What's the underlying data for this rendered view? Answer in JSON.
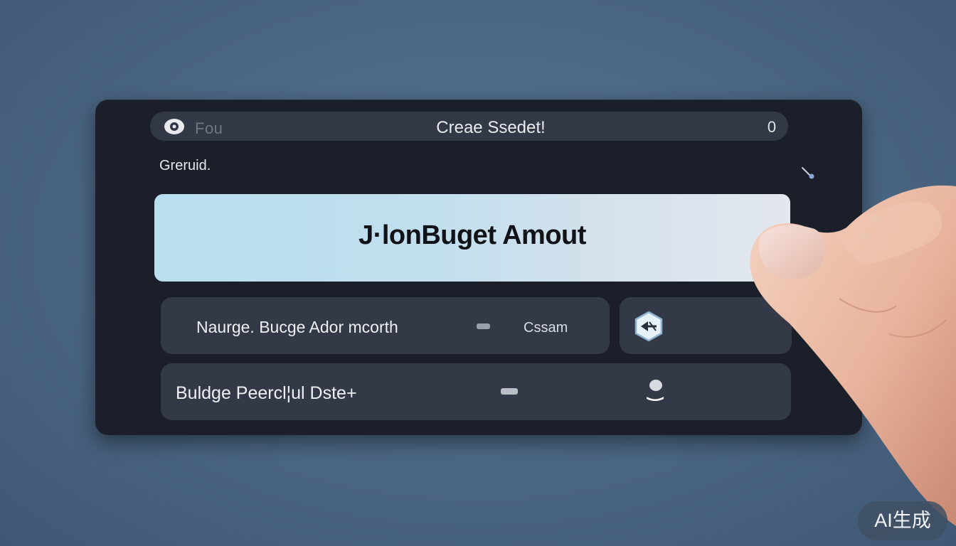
{
  "titlebar": {
    "app_name": "Fou",
    "title": "Creae Ssedet!",
    "badge": "0"
  },
  "section": {
    "label": "Greruid."
  },
  "amount_card": {
    "label": "J·lonBuget Amout"
  },
  "rows": [
    {
      "label": "Naurge. Bucge Ador mcorth",
      "value": "Cssam"
    },
    {
      "label": "Buldge Peercl¦ul Dste+"
    }
  ],
  "watermark": {
    "text": "AI生成"
  },
  "icons": {
    "app": "eye-icon",
    "back": "backspace-icon",
    "row2": "toggle-icon",
    "corner": "pin-icon"
  }
}
